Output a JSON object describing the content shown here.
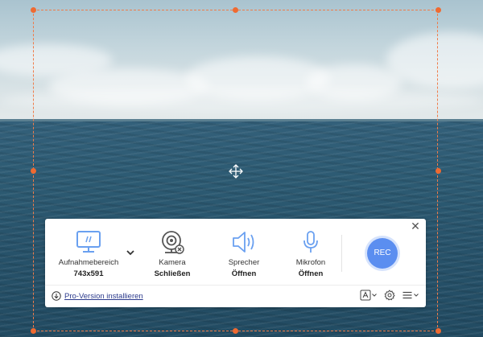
{
  "toolbar": {
    "region": {
      "label": "Aufnahmebereich",
      "value": "743x591"
    },
    "camera": {
      "label": "Kamera",
      "value": "Schließen"
    },
    "speaker": {
      "label": "Sprecher",
      "value": "Öffnen"
    },
    "microphone": {
      "label": "Mikrofon",
      "value": "Öffnen"
    },
    "rec_label": "REC",
    "close_glyph": "✕",
    "upgrade_link": "Pro-Version installieren"
  },
  "icons": {
    "region": "monitor-icon",
    "camera": "webcam-icon",
    "speaker": "speaker-icon",
    "microphone": "microphone-icon",
    "settings": "gear-icon",
    "menu": "hamburger-menu-icon",
    "user_text": "text-box-icon",
    "download": "download-icon",
    "move": "move-arrows-icon"
  },
  "colors": {
    "accent": "#5b8ef0",
    "selection": "#ef7c4a",
    "handle": "#ef6a31",
    "icon_blue": "#6aa0f0",
    "link": "#2b3a8c"
  }
}
